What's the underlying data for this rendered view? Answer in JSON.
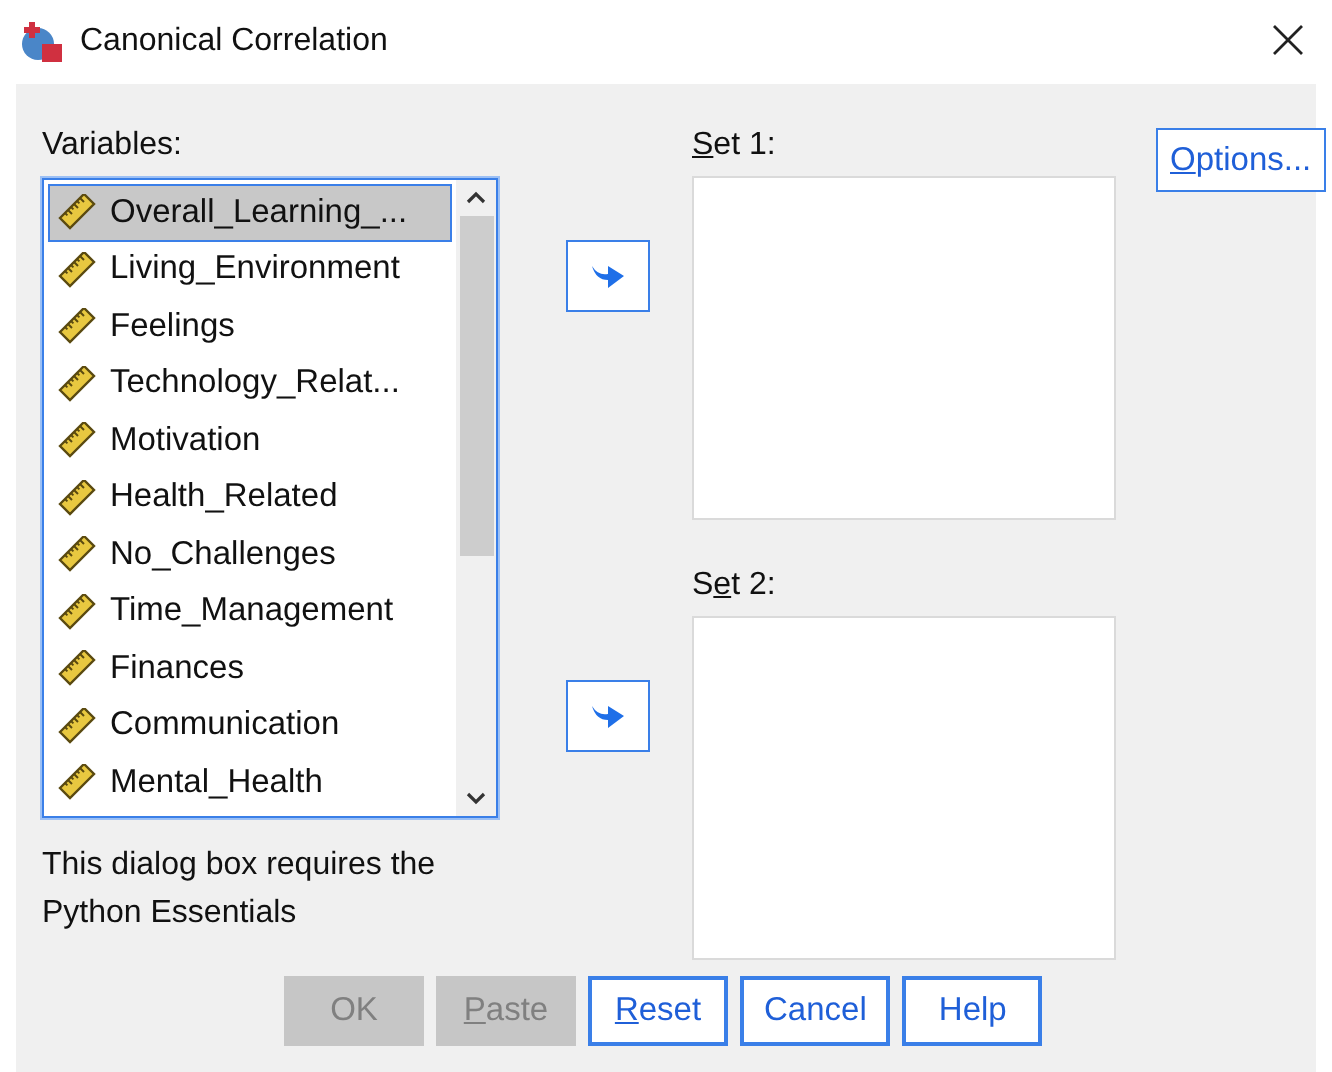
{
  "window": {
    "title": "Canonical Correlation"
  },
  "variables": {
    "label": "Variables:",
    "items": [
      {
        "name": "Overall_Learning_...",
        "selected": true
      },
      {
        "name": "Living_Environment",
        "selected": false
      },
      {
        "name": "Feelings",
        "selected": false
      },
      {
        "name": "Technology_Relat...",
        "selected": false
      },
      {
        "name": "Motivation",
        "selected": false
      },
      {
        "name": "Health_Related",
        "selected": false
      },
      {
        "name": "No_Challenges",
        "selected": false
      },
      {
        "name": "Time_Management",
        "selected": false
      },
      {
        "name": "Finances",
        "selected": false
      },
      {
        "name": "Communication",
        "selected": false
      },
      {
        "name": "Mental_Health",
        "selected": false
      }
    ]
  },
  "sets": [
    {
      "access_key": "S",
      "label_rest": "et 1:"
    },
    {
      "label_start": "S",
      "access_key": "e",
      "label_rest": "t 2:"
    }
  ],
  "options_button": {
    "access_key": "O",
    "label_rest": "ptions..."
  },
  "note": "This dialog box requires the Python Essentials",
  "buttons": [
    {
      "label": "OK",
      "disabled": true
    },
    {
      "access_key": "P",
      "label_rest": "aste",
      "disabled": true
    },
    {
      "access_key": "R",
      "label_rest": "eset",
      "disabled": false
    },
    {
      "label": "Cancel",
      "disabled": false
    },
    {
      "label": "Help",
      "disabled": false
    }
  ]
}
